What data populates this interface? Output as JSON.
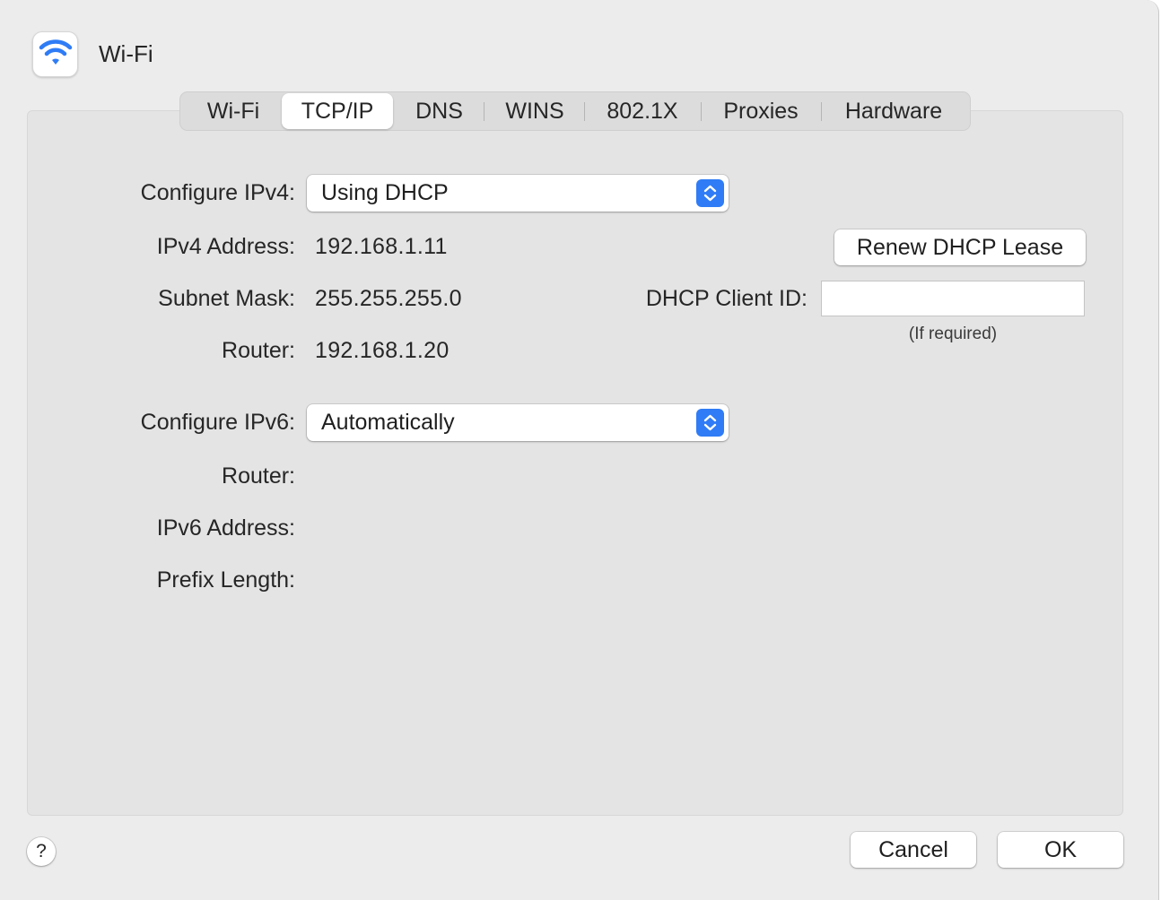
{
  "window": {
    "title": "Wi-Fi",
    "icon": "wifi-icon",
    "accent_color": "#2f7cf6"
  },
  "tabs": [
    {
      "label": "Wi-Fi",
      "active": false
    },
    {
      "label": "TCP/IP",
      "active": true
    },
    {
      "label": "DNS",
      "active": false
    },
    {
      "label": "WINS",
      "active": false
    },
    {
      "label": "802.1X",
      "active": false
    },
    {
      "label": "Proxies",
      "active": false
    },
    {
      "label": "Hardware",
      "active": false
    }
  ],
  "ipv4": {
    "configure_label": "Configure IPv4:",
    "configure_value": "Using DHCP",
    "address_label": "IPv4 Address:",
    "address_value": "192.168.1.11",
    "subnet_label": "Subnet Mask:",
    "subnet_value": "255.255.255.0",
    "router_label": "Router:",
    "router_value": "192.168.1.20"
  },
  "dhcp": {
    "renew_button": "Renew DHCP Lease",
    "client_id_label": "DHCP Client ID:",
    "client_id_value": "",
    "client_id_hint": "(If required)"
  },
  "ipv6": {
    "configure_label": "Configure IPv6:",
    "configure_value": "Automatically",
    "router_label": "Router:",
    "address_label": "IPv6 Address:",
    "prefix_label": "Prefix Length:"
  },
  "footer": {
    "help_label": "?",
    "cancel_label": "Cancel",
    "ok_label": "OK"
  }
}
